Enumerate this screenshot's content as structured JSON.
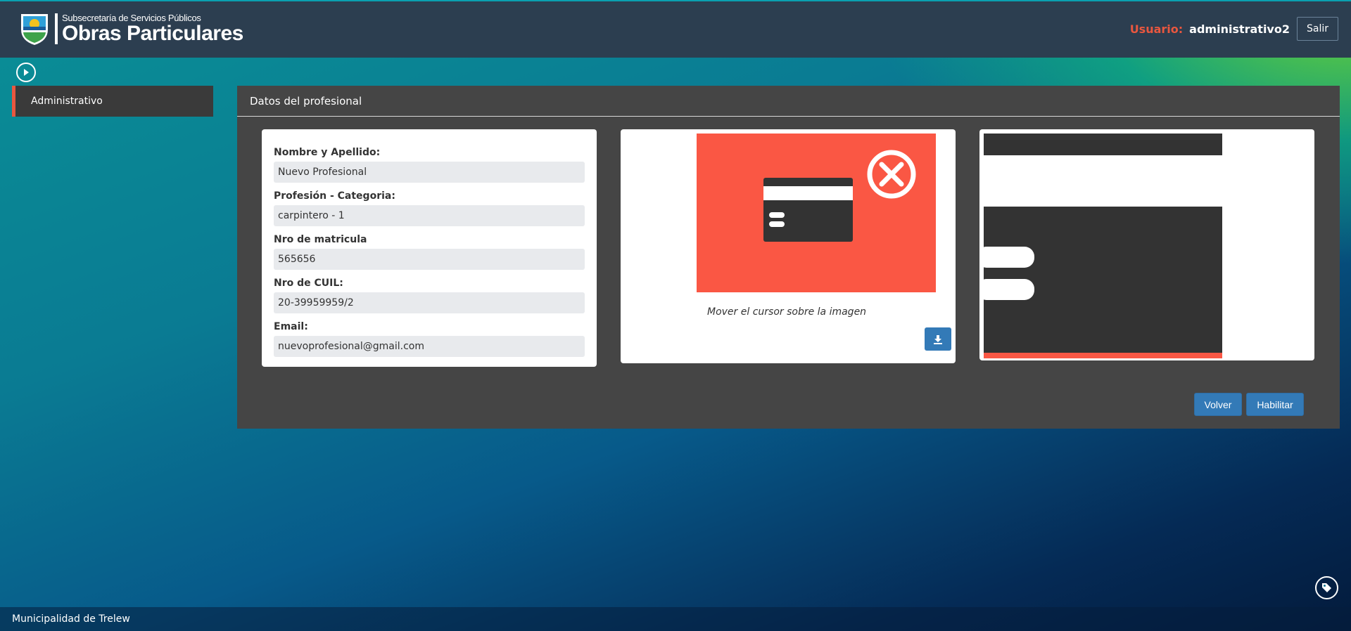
{
  "header": {
    "logo_sub": "Subsecretaría de Servicios Públicos",
    "logo_main": "Obras Particulares",
    "logo_badge": "TRELEW",
    "user_label": "Usuario:",
    "user_name": "administrativo2",
    "logout_label": "Salir"
  },
  "sidebar": {
    "items": [
      {
        "label": "Administrativo",
        "active": true
      }
    ]
  },
  "panel": {
    "title": "Datos del profesional",
    "fields": [
      {
        "label": "Nombre y Apellido:",
        "value": "Nuevo Profesional"
      },
      {
        "label": "Profesión - Categoria:",
        "value": "carpintero - 1"
      },
      {
        "label": "Nro de matricula",
        "value": "565656"
      },
      {
        "label": "Nro de CUIL:",
        "value": "20-39959959/2"
      },
      {
        "label": "Email:",
        "value": "nuevoprofesional@gmail.com"
      }
    ],
    "image_caption": "Mover el cursor sobre la imagen",
    "buttons": {
      "back_label": "Volver",
      "enable_label": "Habilitar"
    }
  },
  "footer": {
    "text": "Municipalidad de Trelew"
  },
  "colors": {
    "header_bg": "#2c3e50",
    "accent": "#e9573f",
    "primary_button": "#337ab7",
    "panel_bg": "#454545",
    "card_error": "#fa5744"
  },
  "icons": {
    "sidebar_toggle": "play-circle-icon",
    "download": "download-icon",
    "tag": "tag-icon",
    "error": "close-circle-icon"
  }
}
